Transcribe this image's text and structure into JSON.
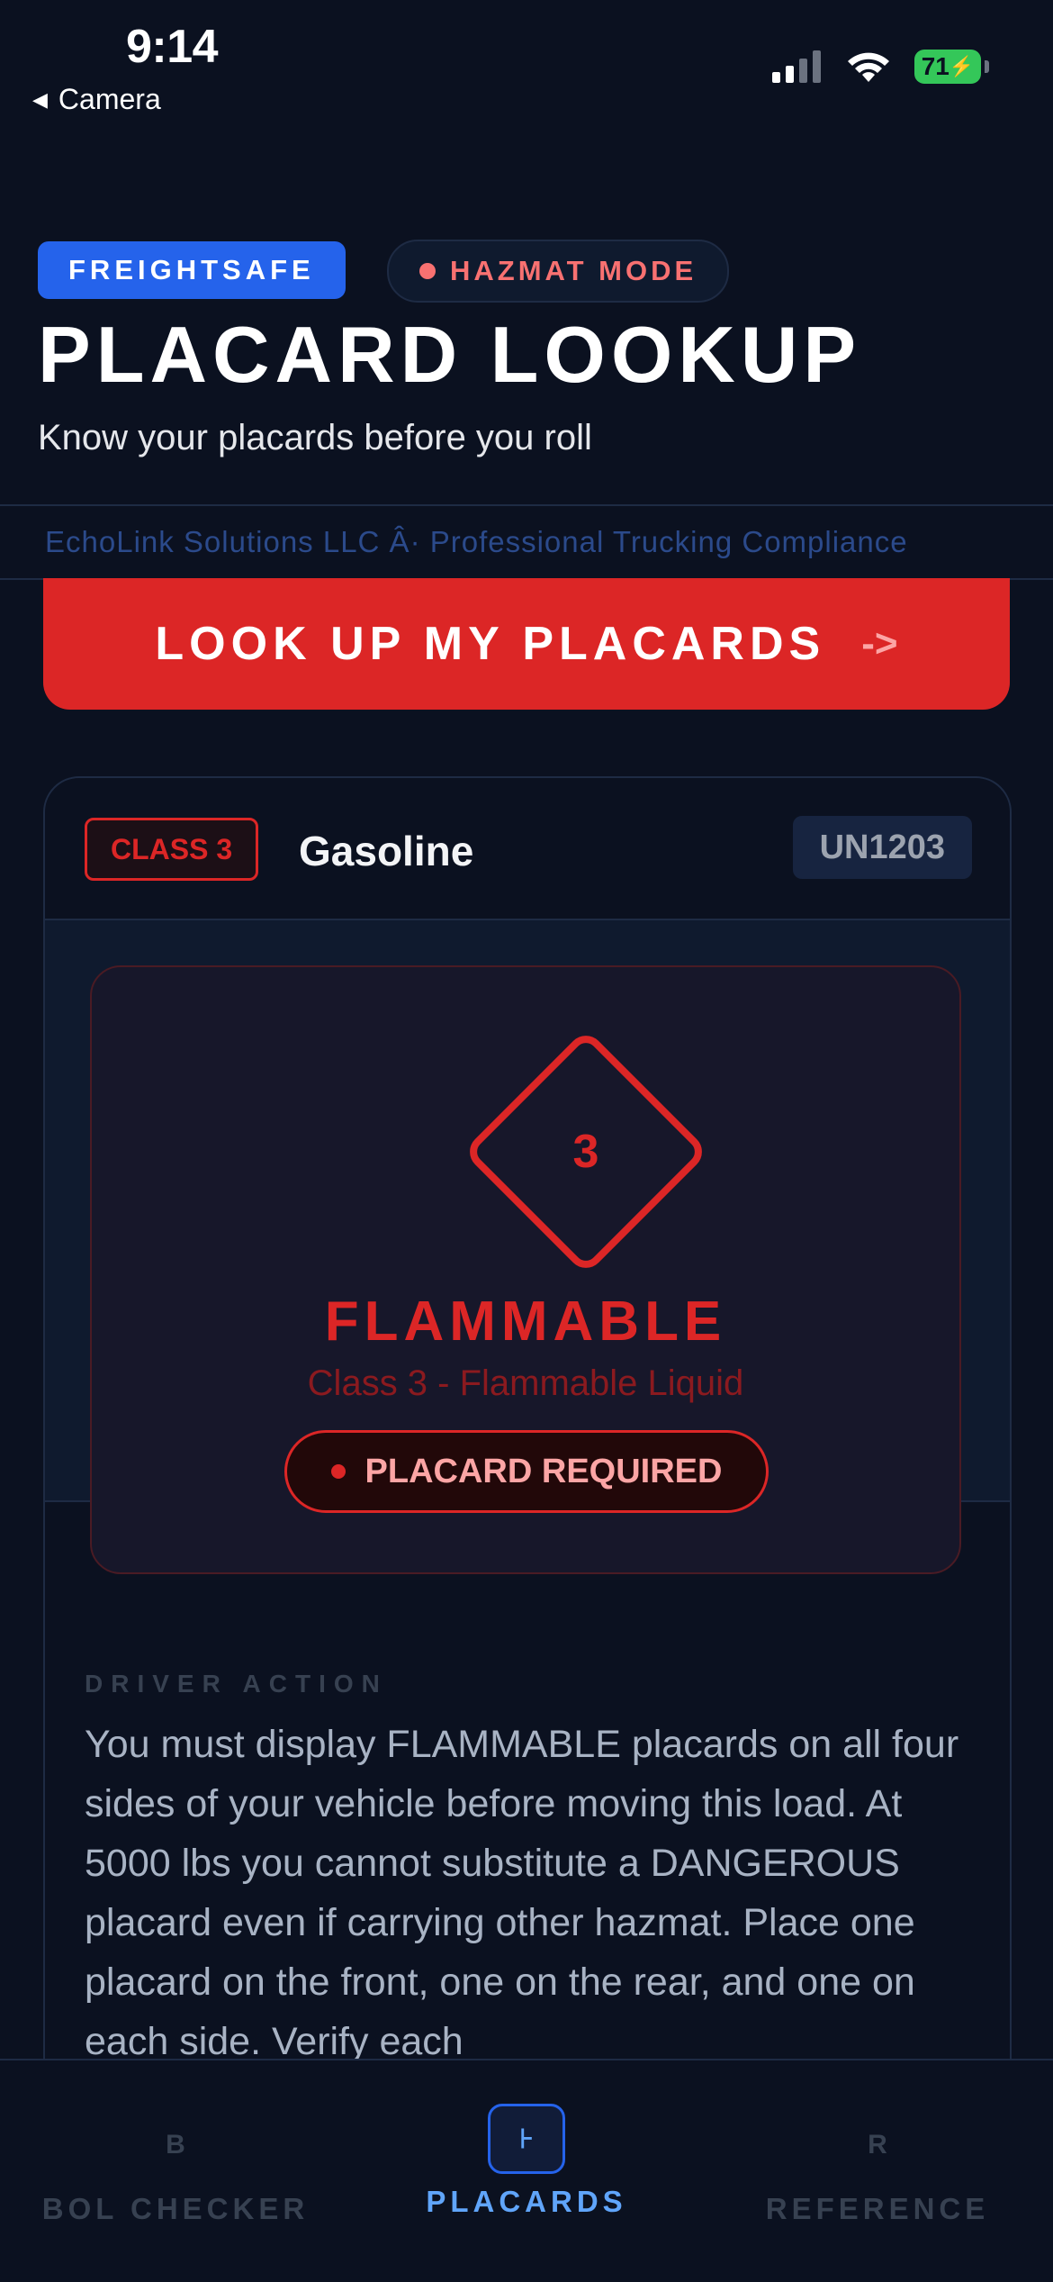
{
  "status_bar": {
    "time": "9:14",
    "back_label": "Camera",
    "battery": "71"
  },
  "header": {
    "brand": "FREIGHTSAFE",
    "mode": "HAZMAT MODE",
    "title": "PLACARD LOOKUP",
    "subtitle": "Know your placards before you roll"
  },
  "company_line": "EchoLink Solutions LLC Â· Professional Trucking Compliance",
  "cta": {
    "label": "LOOK UP MY PLACARDS",
    "arrow": "->"
  },
  "result_card": {
    "class_badge": "CLASS 3",
    "material": "Gasoline",
    "un_number": "UN1203",
    "placard_number": "3",
    "hazard_name": "FLAMMABLE",
    "hazard_description": "Class 3 - Flammable Liquid",
    "status": "PLACARD REQUIRED",
    "action_label": "DRIVER ACTION",
    "action_text": "You must display FLAMMABLE placards on all four sides of your vehicle before moving this load. At 5000 lbs you cannot substitute a DANGEROUS placard even if carrying other hazmat. Place one placard on the front, one on the rear, and one on each side. Verify each"
  },
  "tabs": [
    {
      "icon": "B",
      "label": "BOL CHECKER"
    },
    {
      "icon": "⊦",
      "label": "PLACARDS"
    },
    {
      "icon": "R",
      "label": "REFERENCE"
    }
  ],
  "colors": {
    "background": "#0b1120",
    "accent_blue": "#2563eb",
    "danger_red": "#dc2626",
    "battery_green": "#34c759"
  }
}
